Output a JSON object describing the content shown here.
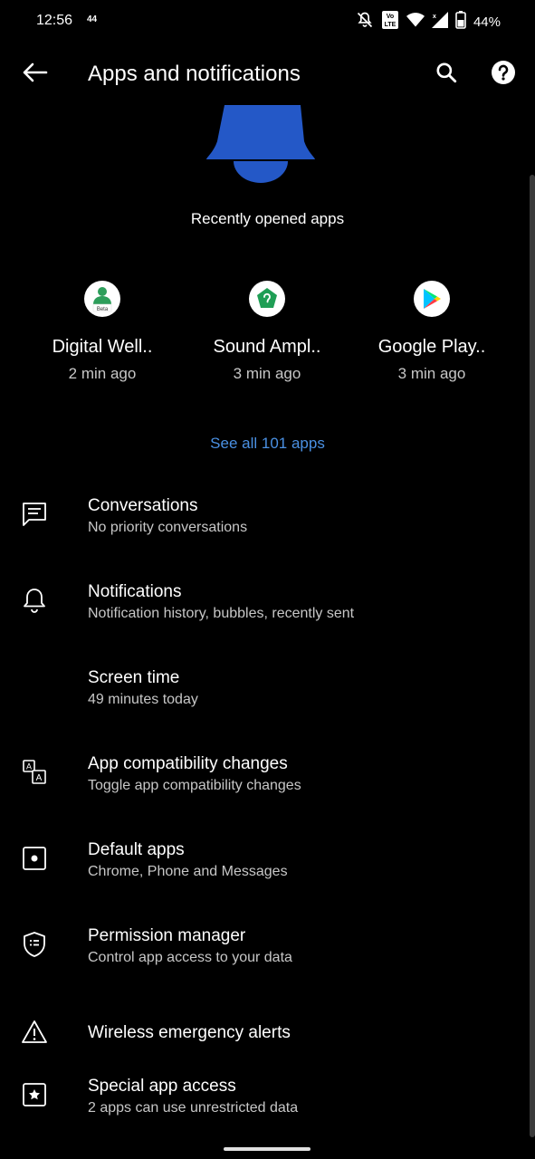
{
  "status_bar": {
    "time": "12:56",
    "extra": "44",
    "battery": "44%",
    "icons": [
      "bell-off-icon",
      "volte-icon",
      "wifi-icon",
      "signal-icon",
      "battery-icon"
    ]
  },
  "app_bar": {
    "title": "Apps and notifications",
    "back_icon": "arrow-left-icon",
    "search_icon": "search-icon",
    "help_icon": "help-icon"
  },
  "recent": {
    "title": "Recently opened apps",
    "apps": [
      {
        "name": "Digital Well..",
        "time": "2 min ago",
        "icon": "digital-wellbeing-icon",
        "badge": "Beta"
      },
      {
        "name": "Sound Ampl..",
        "time": "3 min ago",
        "icon": "sound-amplifier-icon"
      },
      {
        "name": "Google Play..",
        "time": "3 min ago",
        "icon": "google-play-icon"
      }
    ],
    "see_all": "See all 101 apps"
  },
  "items": [
    {
      "title": "Conversations",
      "subtitle": "No priority conversations",
      "icon": "chat-icon"
    },
    {
      "title": "Notifications",
      "subtitle": "Notification history, bubbles, recently sent",
      "icon": "bell-icon"
    },
    {
      "title": "Screen time",
      "subtitle": "49 minutes today",
      "icon": ""
    },
    {
      "title": "App compatibility changes",
      "subtitle": "Toggle app compatibility changes",
      "icon": "translate-icon"
    },
    {
      "title": "Default apps",
      "subtitle": "Chrome, Phone and Messages",
      "icon": "default-apps-icon"
    },
    {
      "title": "Permission manager",
      "subtitle": "Control app access to your data",
      "icon": "shield-list-icon"
    },
    {
      "title": "Wireless emergency alerts",
      "subtitle": "",
      "icon": "warning-icon"
    },
    {
      "title": "Special app access",
      "subtitle": "2 apps can use unrestricted data",
      "icon": "star-box-icon"
    }
  ],
  "colors": {
    "background": "#000000",
    "accent_link": "#4a90e2",
    "hero_bell": "#2458c7",
    "subtitle": "#c7c7c7"
  }
}
